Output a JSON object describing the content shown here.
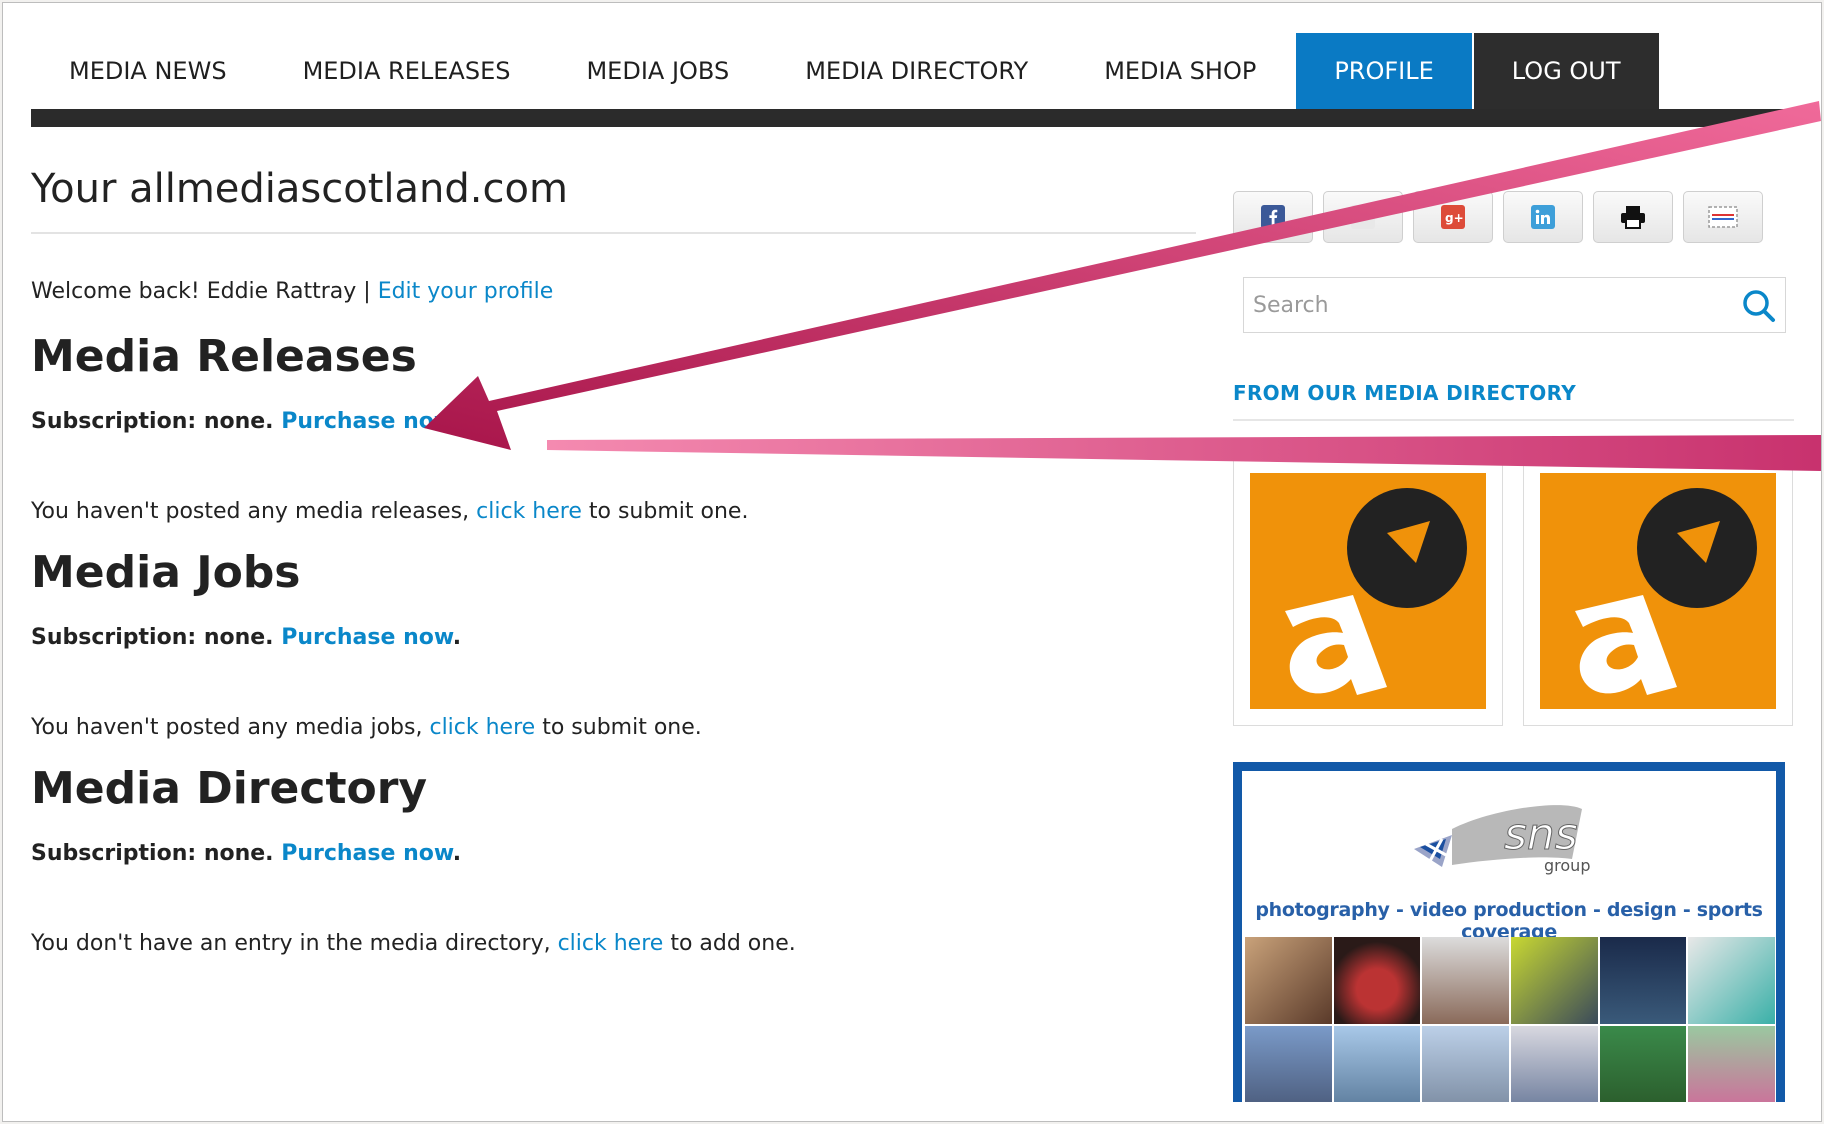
{
  "nav": {
    "items": [
      "MEDIA NEWS",
      "MEDIA RELEASES",
      "MEDIA JOBS",
      "MEDIA DIRECTORY",
      "MEDIA SHOP"
    ],
    "profile": "PROFILE",
    "logout": "LOG OUT"
  },
  "page": {
    "title": "Your allmediascotland.com",
    "welcome": "Welcome back! Eddie Rattray |",
    "edit_profile": "Edit your profile"
  },
  "sections": [
    {
      "heading": "Media Releases",
      "sub_label": "Subscription: none.",
      "sub_link": "Purchase now",
      "sub_end": ".",
      "info_pre": "You haven't posted any media releases,",
      "info_link": "click here",
      "info_post": "to submit one."
    },
    {
      "heading": "Media Jobs",
      "sub_label": "Subscription: none.",
      "sub_link": "Purchase now",
      "sub_end": ".",
      "info_pre": "You haven't posted any media jobs,",
      "info_link": "click here",
      "info_post": "to submit one."
    },
    {
      "heading": "Media Directory",
      "sub_label": "Subscription: none.",
      "sub_link": "Purchase now",
      "sub_end": ".",
      "info_pre": "You don't have an entry in the media directory,",
      "info_link": "click here",
      "info_post": "to add one."
    }
  ],
  "sidebar": {
    "share_icons": [
      "facebook-icon",
      "twitter-icon",
      "google-plus-icon",
      "linkedin-icon",
      "print-icon",
      "email-icon"
    ],
    "search_placeholder": "Search",
    "directory_heading": "FROM OUR MEDIA DIRECTORY",
    "ad": {
      "brand": "sns",
      "brand_sub": "group",
      "tagline": "photography - video production - design - sports coverage"
    }
  },
  "colors": {
    "accent": "#0a87c9",
    "profile_tab": "#0a7ac4",
    "logout_tab": "#2d2d2d",
    "logo_orange": "#f0920a",
    "ad_border": "#1259a8",
    "arrow": "#c2185b"
  }
}
